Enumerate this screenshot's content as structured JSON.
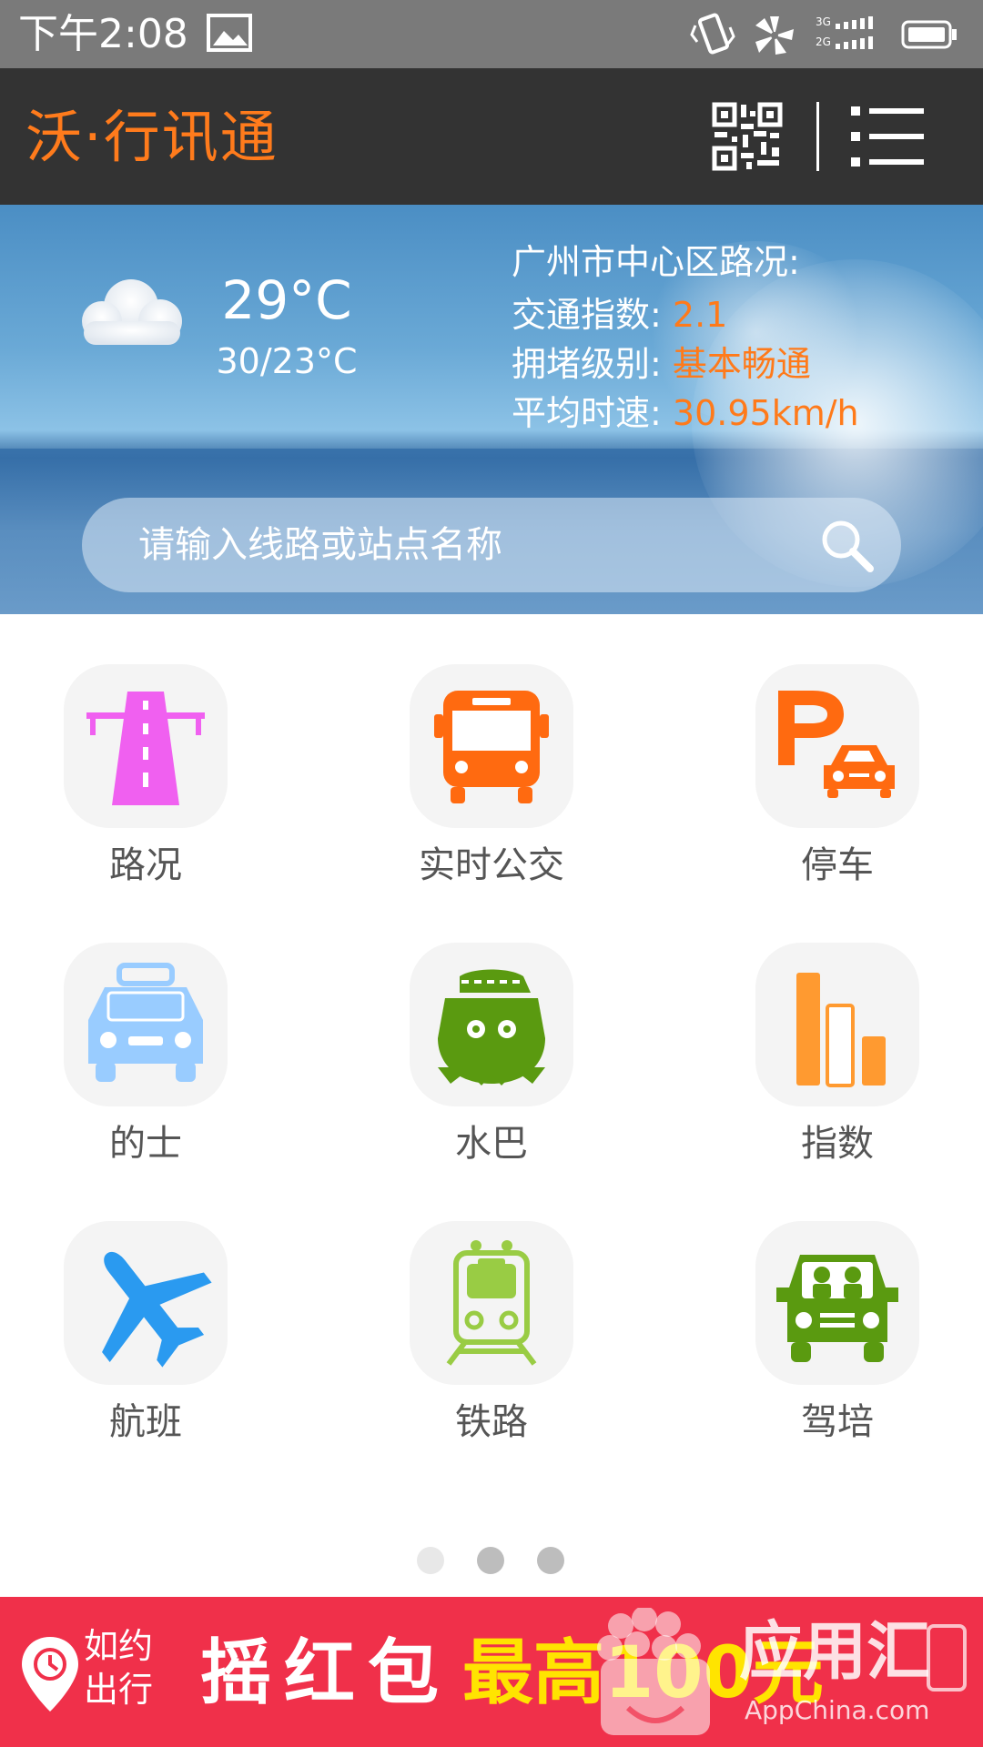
{
  "status_bar": {
    "time": "下午2:08"
  },
  "header": {
    "brand": "沃·行讯通",
    "qr_icon": "qr-code-icon",
    "menu_icon": "menu-icon"
  },
  "weather": {
    "temp": "29°C",
    "range": "30/23°C",
    "icon": "cloud-icon"
  },
  "traffic": {
    "title": "广州市中心区路况:",
    "index_label": "交通指数:",
    "index_value": "2.1",
    "level_label": "拥堵级别:",
    "level_value": "基本畅通",
    "speed_label": "平均时速:",
    "speed_value": "30.95km/h",
    "accent_color": "#ff7a1a"
  },
  "search": {
    "placeholder": "请输入线路或站点名称"
  },
  "grid": [
    {
      "label": "路况",
      "icon": "road-icon",
      "color": "#f060f0"
    },
    {
      "label": "实时公交",
      "icon": "bus-icon",
      "color": "#ff6a10"
    },
    {
      "label": "停车",
      "icon": "parking-icon",
      "color": "#ff6a10"
    },
    {
      "label": "的士",
      "icon": "taxi-icon",
      "color": "#99ccff"
    },
    {
      "label": "水巴",
      "icon": "water-bus-icon",
      "color": "#5a9a10"
    },
    {
      "label": "指数",
      "icon": "index-bars-icon",
      "color": "#ff9a30"
    },
    {
      "label": "航班",
      "icon": "airplane-icon",
      "color": "#2a9af0"
    },
    {
      "label": "铁路",
      "icon": "train-icon",
      "color": "#99cc44"
    },
    {
      "label": "驾培",
      "icon": "driving-school-icon",
      "color": "#5a9a10"
    }
  ],
  "pagination": {
    "pages": 3,
    "active": 0
  },
  "banner": {
    "brand": "如约出行",
    "promo": "摇红包",
    "promo2": "最高100元",
    "watermark": "应用汇",
    "watermark_sub": "AppChina.com"
  }
}
